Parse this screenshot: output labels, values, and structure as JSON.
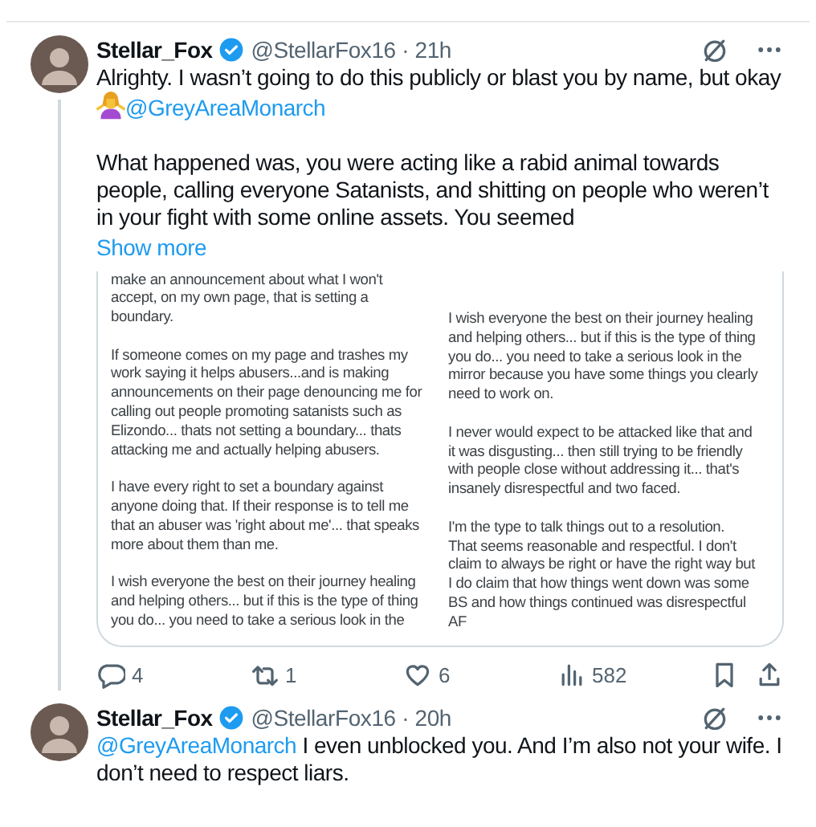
{
  "tweets": [
    {
      "name": "Stellar_Fox",
      "verified": true,
      "meta": "@StellarFox16 · 21h",
      "connected": true,
      "paragraphs": [
        [
          {
            "kind": "text",
            "text": "Alrighty. I wasn’t going to do this publicly or blast you by name, but okay "
          },
          {
            "kind": "emoji"
          },
          {
            "kind": "mention",
            "text": "@GreyAreaMonarch"
          }
        ],
        [
          {
            "kind": "text",
            "text": "What happened was, you were acting like a rabid animal towards people, calling everyone Satanists, and shitting on people who weren’t in your fight with some online assets. You seemed"
          }
        ]
      ],
      "show_more": "Show more",
      "attached_image": {
        "columns": [
          {
            "paragraphs": [
              [
                "make an announcement about what I won't",
                "accept, on my own page, that is setting a",
                "boundary."
              ],
              [
                "If someone comes on my page and trashes my",
                "work saying it helps abusers...and is making",
                "announcements on their page denouncing me for",
                "calling out people promoting satanists such as",
                "Elizondo... thats not setting a boundary... thats",
                "attacking me and actually helping abusers."
              ],
              [
                "I have every right to set a boundary against",
                "anyone doing that. If their response is to tell me",
                "that an abuser was 'right about me'... that speaks",
                "more about them than me."
              ],
              [
                "I wish everyone the best on their journey healing",
                "and helping others... but if this is the type of thing",
                "you do... you need to take a serious look in the"
              ]
            ]
          },
          {
            "paragraphs": [
              [
                "I wish everyone the best on their journey healing",
                "and helping others... but if this is the type of thing",
                "you do... you need to take a serious look in the",
                "mirror because you have some things you clearly",
                "need to work on."
              ],
              [
                "I never would expect to be attacked like that and",
                "it was disgusting... then still trying to be friendly",
                "with people close without addressing it... that's",
                "insanely disrespectful and two faced."
              ],
              [
                "I'm the type to talk things out to a resolution.",
                "That seems reasonable and respectful. I don't",
                "claim to always be right or have the right way but",
                "I do claim that how things went down was some",
                "BS and how things continued was disrespectful",
                "AF"
              ]
            ]
          }
        ]
      },
      "actions": [
        {
          "kind": "reply",
          "count": "4"
        },
        {
          "kind": "repost",
          "count": "1"
        },
        {
          "kind": "like",
          "count": "6"
        },
        {
          "kind": "views",
          "count": "582"
        },
        {
          "kind": "bookmark"
        },
        {
          "kind": "share"
        }
      ]
    },
    {
      "name": "Stellar_Fox",
      "verified": true,
      "meta": "@StellarFox16 · 20h",
      "connected": false,
      "paragraphs": [
        [
          {
            "kind": "mention",
            "text": "@GreyAreaMonarch"
          },
          {
            "kind": "text",
            "text": " I even unblocked you. And I’m also not your wife. I don’t need to respect liars."
          }
        ]
      ]
    }
  ]
}
